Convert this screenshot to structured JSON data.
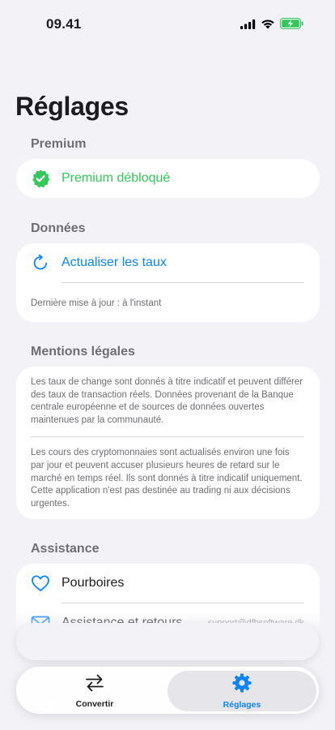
{
  "status_bar": {
    "time": "09.41",
    "icons": [
      "cellular-signal-icon",
      "wifi-icon",
      "battery-charging-icon"
    ]
  },
  "page": {
    "title": "Réglages"
  },
  "colors": {
    "accent_blue": "#0a84ff",
    "success_green": "#34c759",
    "background": "#f2f2f7"
  },
  "premium": {
    "header": "Premium",
    "status_label": "Premium débloqué",
    "icon": "verified-badge-icon"
  },
  "data_section": {
    "header": "Données",
    "refresh_label": "Actualiser les taux",
    "refresh_icon": "refresh-icon",
    "last_update": "Dernière mise à jour : à l'instant"
  },
  "legal": {
    "header": "Mentions légales",
    "paragraph_1": "Les taux de change sont donnés à titre indicatif et peuvent différer des taux de transaction réels. Données provenant de la Banque centrale européenne et de sources de données ouvertes maintenues par la communauté.",
    "paragraph_2": "Les cours des cryptomonnaies sont actualisés environ une fois par jour et peuvent accuser plusieurs heures de retard sur le marché en temps réel. Ils sont donnés à titre indicatif uniquement. Cette application n'est pas destinée au trading ni aux décisions urgentes."
  },
  "assistance": {
    "header": "Assistance",
    "tips_label": "Pourboires",
    "tips_icon": "heart-icon",
    "support_label": "Assistance et retours",
    "support_email": "support@dfbsoftware.dk",
    "support_icon": "mail-icon"
  },
  "tab_bar": {
    "tabs": [
      {
        "label": "Convertir",
        "icon": "swap-arrows-icon",
        "active": false
      },
      {
        "label": "Réglages",
        "icon": "gear-icon",
        "active": true
      }
    ]
  }
}
